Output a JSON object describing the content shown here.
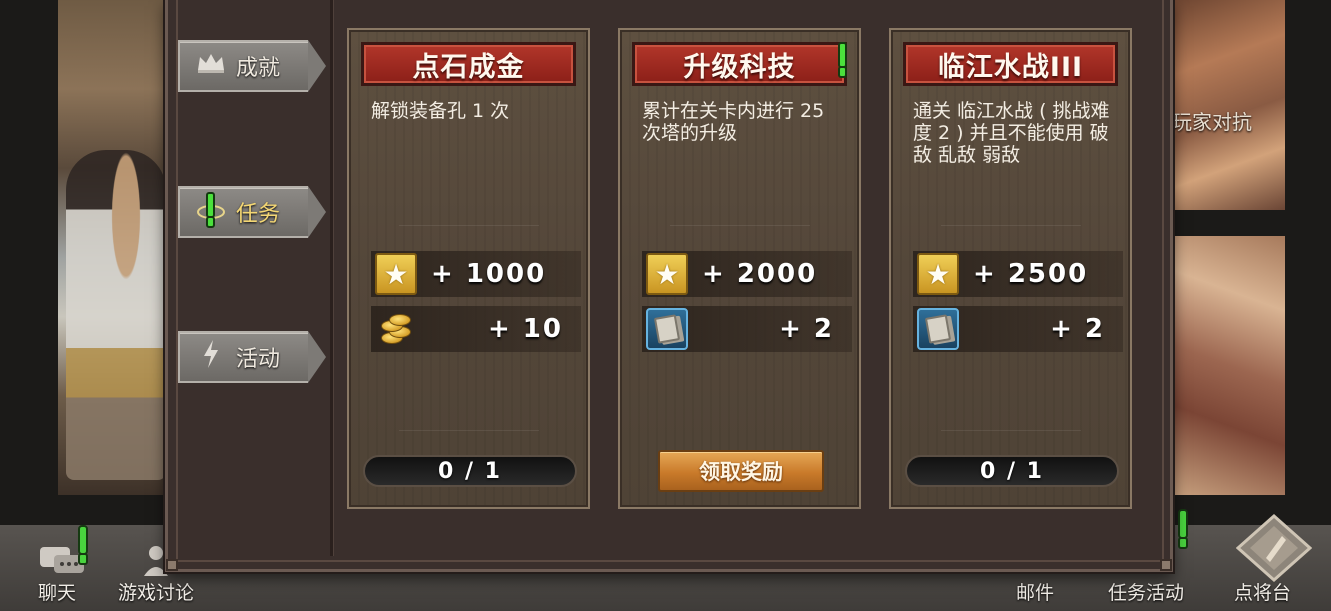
{
  "side_tabs": [
    {
      "label": "成就",
      "icon": "crown-icon",
      "active": false
    },
    {
      "label": "任务",
      "icon": "eye-alert-icon",
      "active": true
    },
    {
      "label": "活动",
      "icon": "lightning-icon",
      "active": false
    }
  ],
  "quests": [
    {
      "title": "点石成金",
      "description": "解锁装备孔 1 次",
      "rewards": [
        {
          "icon": "star-icon",
          "value": "+ 1000"
        },
        {
          "icon": "gold-coins-icon",
          "value": "+ 10"
        }
      ],
      "progress": "0 / 1",
      "has_alert": false
    },
    {
      "title": "升级科技",
      "description": "累计在关卡内进行 25 次塔的升级",
      "rewards": [
        {
          "icon": "star-icon",
          "value": "+ 2000"
        },
        {
          "icon": "card-icon",
          "value": "+ 2"
        }
      ],
      "claim_label": "领取奖励",
      "has_alert": true
    },
    {
      "title": "临江水战III",
      "description": "通关 临江水战 ( 挑战难度 2 ) 并且不能使用 破敌 乱敌 弱敌",
      "rewards": [
        {
          "icon": "star-icon",
          "value": "+ 2500"
        },
        {
          "icon": "card-icon",
          "value": "+ 2"
        }
      ],
      "progress": "0 / 1",
      "has_alert": false
    }
  ],
  "bottom_bar": {
    "chat": "聊天",
    "discussion": "游戏讨论",
    "mail": "邮件",
    "quest_activity": "任务活动",
    "general_stage": "点将台"
  },
  "background": {
    "right_label": "玩家对抗"
  },
  "colors": {
    "title_red": "#a02a20",
    "alert_green": "#49d43e",
    "claim_orange": "#d58a36",
    "active_tab_text": "#f4d774"
  }
}
